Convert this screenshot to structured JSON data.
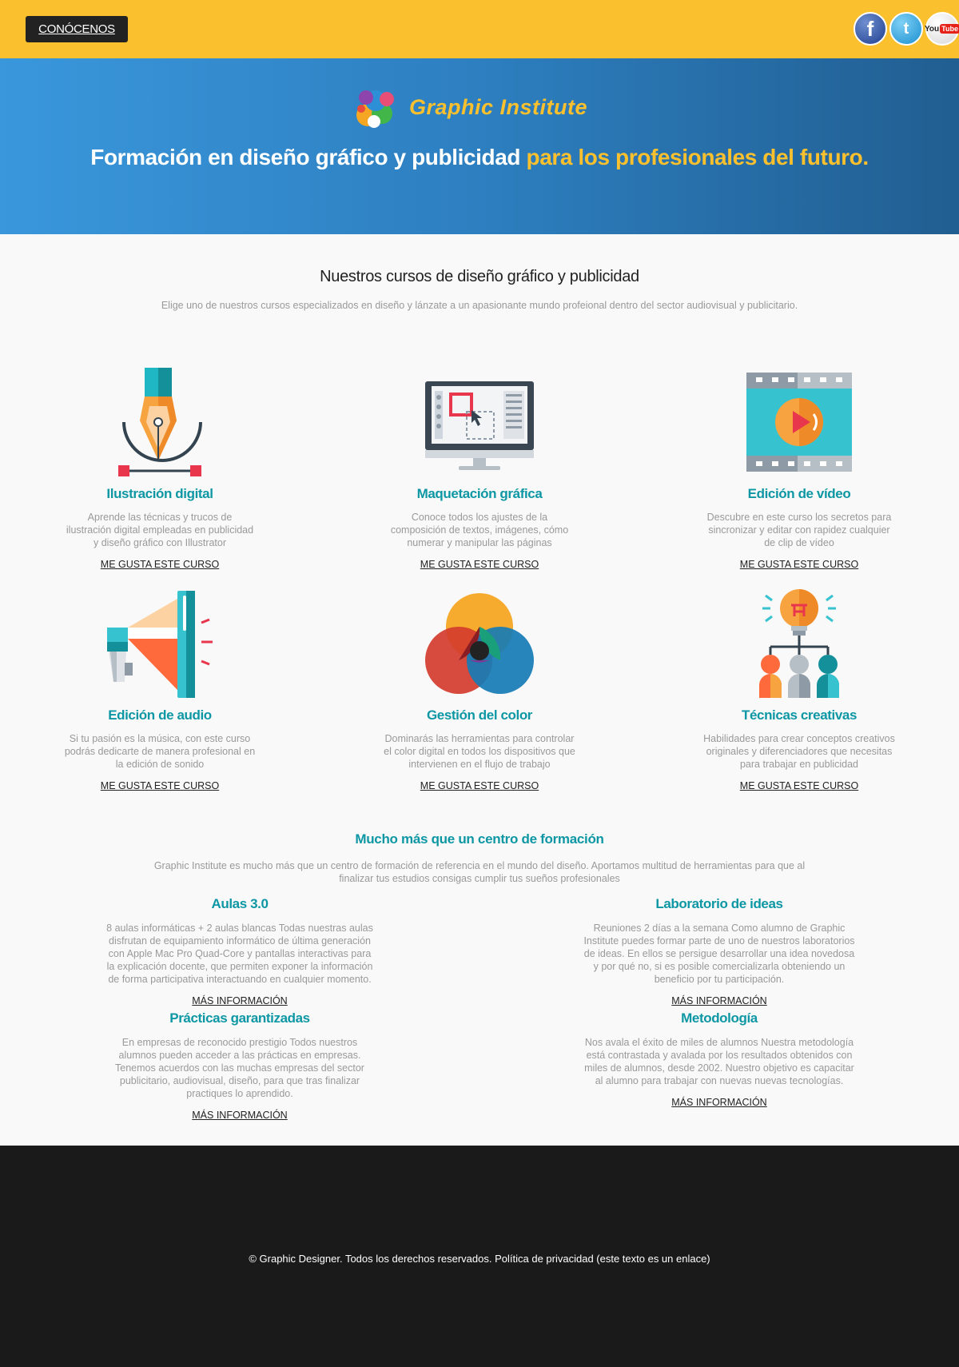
{
  "topbar": {
    "button_label": "CONÓCENOS",
    "social": [
      {
        "name": "facebook-icon",
        "glyph": "f"
      },
      {
        "name": "twitter-icon",
        "glyph": "t"
      },
      {
        "name": "youtube-icon",
        "glyph_you": "You",
        "glyph_tube": "Tube"
      }
    ]
  },
  "hero": {
    "brand": "Graphic Institute",
    "title_part1": "Formación en diseño gráfico y publicidad",
    "title_part2": "para los profesionales del futuro."
  },
  "courses_section": {
    "title": "Nuestros cursos de diseño gráfico y publicidad",
    "subtitle": "Elige uno de nuestros cursos especializados en diseño y lánzate a un apasionante mundo profeional dentro del sector audiovisual y publicitario."
  },
  "courses": [
    {
      "title": "Ilustración digital",
      "desc": "Aprende las técnicas y trucos de ilustración digital empleadas en publicidad y diseño gráfico con Illustrator",
      "link": "ME GUSTA ESTE CURSO",
      "icon": "pen-tool-icon"
    },
    {
      "title": "Maquetación gráfica",
      "desc": "Conoce todos los ajustes de la composición de textos, imágenes, cómo numerar y manipular las páginas",
      "link": "ME GUSTA ESTE CURSO",
      "icon": "monitor-layout-icon"
    },
    {
      "title": "Edición de vídeo",
      "desc": "Descubre en este curso los secretos para sincronizar y editar con rapidez cualquier de clip de vídeo",
      "link": "ME GUSTA ESTE CURSO",
      "icon": "video-film-icon"
    },
    {
      "title": "Edición de audio",
      "desc": "Si tu pasión es la música, con este curso podrás dedicarte de manera profesional en la edición de sonido",
      "link": "ME GUSTA ESTE CURSO",
      "icon": "megaphone-icon"
    },
    {
      "title": "Gestión del color",
      "desc": "Dominarás las herramientas para controlar el color digital en todos los dispositivos que intervienen en el flujo de trabajo",
      "link": "ME GUSTA ESTE CURSO",
      "icon": "color-circles-icon"
    },
    {
      "title": "Técnicas creativas",
      "desc": "Habilidades para crear conceptos creativos originales y diferenciadores que necesitas para trabajar en publicidad",
      "link": "ME GUSTA ESTE CURSO",
      "icon": "lightbulb-team-icon"
    }
  ],
  "more": {
    "title": "Mucho más que un centro de formación",
    "desc": "Graphic Institute es mucho más que un centro de formación de referencia en el mundo del diseño. Aportamos multitud de herramientas para que al finalizar tus estudios consigas cumplir tus sueños profesionales"
  },
  "features": [
    {
      "title": "Aulas 3.0",
      "desc": "8 aulas informáticas + 2 aulas blancas Todas nuestras aulas disfrutan de equipamiento informático de última generación con Apple Mac Pro Quad-Core y pantallas interactivas para la explicación docente, que permiten exponer la información de forma participativa interactuando en cualquier momento.",
      "link": "MÁS INFORMACIÓN"
    },
    {
      "title": "Laboratorio de ideas",
      "desc": "Reuniones 2 días a la semana Como alumno de Graphic Institute puedes formar parte de uno de nuestros laboratorios de ideas. En ellos se persigue desarrollar una idea novedosa y por qué no, si es posible comercializarla obteniendo un beneficio por tu participación.",
      "link": "MÁS INFORMACIÓN"
    },
    {
      "title": "Prácticas garantizadas",
      "desc": "En empresas de reconocido prestigio Todos nuestros alumnos pueden acceder a las prácticas en empresas. Tenemos acuerdos con las muchas empresas del sector publicitario, audiovisual, diseño, para que tras finalizar practiques lo aprendido.",
      "link": "MÁS INFORMACIÓN"
    },
    {
      "title": "Metodología",
      "desc": "Nos avala el éxito de miles de alumnos Nuestra metodología está contrastada y avalada por los resultados obtenidos con miles de alumnos, desde 2002. Nuestro objetivo es capacitar al alumno para trabajar con nuevas nuevas tecnologías.",
      "link": "MÁS INFORMACIÓN"
    }
  ],
  "footer": {
    "text": "© Graphic Designer. Todos los derechos reservados. Política de privacidad (este texto es un enlace)"
  },
  "colors": {
    "topbar": "#fbc02d",
    "hero_start": "#3a97db",
    "hero_end": "#215e91",
    "accent": "#0d97a4",
    "footer": "#1a1a1a"
  }
}
